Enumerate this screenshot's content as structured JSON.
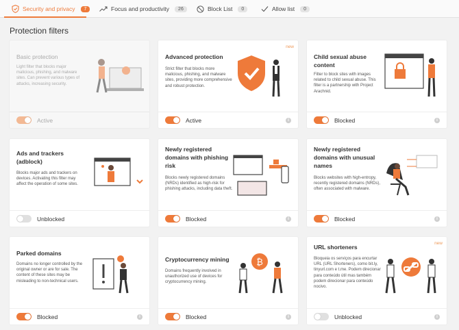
{
  "colors": {
    "accent": "#ee7a3a",
    "background": "#f2f2f2",
    "card": "#ffffff"
  },
  "tabs": [
    {
      "label": "Security and privacy",
      "count": "7",
      "icon": "shield-icon",
      "active": true
    },
    {
      "label": "Focus and productivity",
      "count": "26",
      "icon": "trend-up-icon",
      "active": false
    },
    {
      "label": "Block List",
      "count": "0",
      "icon": "block-icon",
      "active": false
    },
    {
      "label": "Allow list",
      "count": "0",
      "icon": "check-icon",
      "active": false
    }
  ],
  "section_title": "Protection filters",
  "new_badge": "new",
  "info_glyph": "i",
  "cards": [
    {
      "title": "Basic protection",
      "desc": "Light filter that blocks major malicious, phishing, and malware sites. Can prevent various types of attacks, increasing security.",
      "status": "Active",
      "toggle_on": true,
      "disabled": true,
      "new": false,
      "illustration": "laptop-person-illustration"
    },
    {
      "title": "Advanced protection",
      "desc": "Strict filter that blocks more malicious, phishing, and malware sites, providing more comprehensive and robust protection.",
      "status": "Active",
      "toggle_on": true,
      "disabled": false,
      "new": true,
      "illustration": "shield-person-illustration"
    },
    {
      "title": "Child sexual abuse content",
      "desc": "Filter to block sites with images related to child sexual abuse. This filter is a partnership with Project Arachnid.",
      "status": "Blocked",
      "toggle_on": true,
      "disabled": false,
      "new": false,
      "illustration": "browser-lock-illustration"
    },
    {
      "title": "Ads and trackers (adblock)",
      "desc": "Blocks major ads and trackers on devices. Activating this filter may affect the operation of some sites.",
      "status": "Unblocked",
      "toggle_on": false,
      "disabled": false,
      "new": false,
      "illustration": "ad-window-illustration"
    },
    {
      "title": "Newly registered domains with phishing risk",
      "desc": "Blocks newly registered domains (NRDs) identified as high-risk for phishing attacks, including data theft.",
      "status": "Blocked",
      "toggle_on": true,
      "disabled": false,
      "new": false,
      "illustration": "devices-phishing-illustration"
    },
    {
      "title": "Newly registered domains with unusual names",
      "desc": "Blocks websites with high-entropy, recently registered domains (NRDs), often associated with malware.",
      "status": "Blocked",
      "toggle_on": true,
      "disabled": false,
      "new": false,
      "illustration": "person-chair-illustration"
    },
    {
      "title": "Parked domains",
      "desc": "Domains no longer controlled by the original owner or are for sale. The content of these sites may be misleading to non-technical users.",
      "status": "Blocked",
      "toggle_on": true,
      "disabled": false,
      "new": false,
      "illustration": "warning-door-illustration"
    },
    {
      "title": "Cryptocurrency mining",
      "desc": "Domains frequently involved in unauthorized use of devices for cryptocurrency mining.",
      "status": "Blocked",
      "toggle_on": true,
      "disabled": false,
      "new": false,
      "illustration": "bitcoin-people-illustration"
    },
    {
      "title": "URL shorteners",
      "desc": "Bloqueia os serviços para encurtar URL (URL Shorteners), como bit.ly, tinyurl.com e t.me. Podem direcionar para conteúdo útil mas também podem direcionar para conteúdo nocivo.",
      "status": "Unblocked",
      "toggle_on": false,
      "disabled": false,
      "new": true,
      "illustration": "link-people-illustration"
    }
  ]
}
